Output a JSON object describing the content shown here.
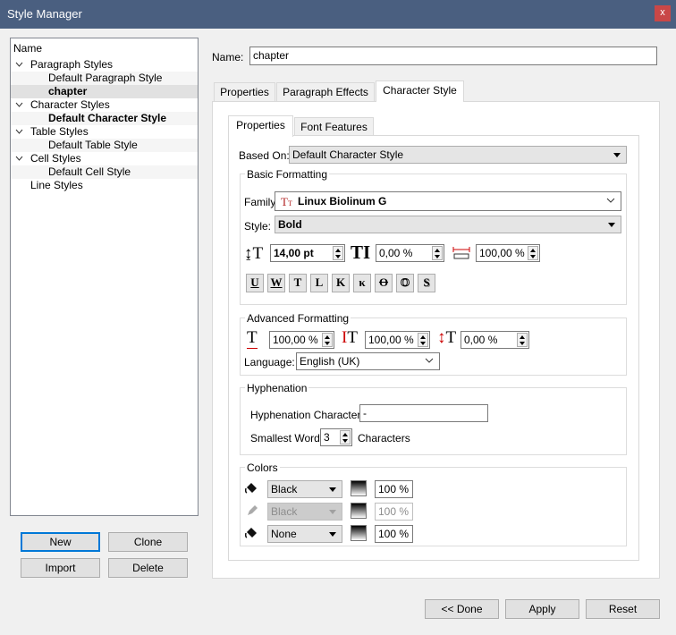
{
  "window": {
    "title": "Style Manager",
    "close_glyph": "x"
  },
  "tree": {
    "header": "Name",
    "items": [
      {
        "label": "Paragraph Styles"
      },
      {
        "label": "Default Paragraph Style"
      },
      {
        "label": "chapter"
      },
      {
        "label": "Character Styles"
      },
      {
        "label": "Default Character Style"
      },
      {
        "label": "Table Styles"
      },
      {
        "label": "Default Table Style"
      },
      {
        "label": "Cell Styles"
      },
      {
        "label": "Default Cell Style"
      },
      {
        "label": "Line Styles"
      }
    ]
  },
  "left_buttons": {
    "new": "New",
    "clone": "Clone",
    "import": "Import",
    "delete": "Delete"
  },
  "name_field": {
    "label": "Name:",
    "value": "chapter"
  },
  "outer_tabs": [
    "Properties",
    "Paragraph Effects",
    "Character Style"
  ],
  "inner_tabs": [
    "Properties",
    "Font Features"
  ],
  "based_on": {
    "label": "Based On:",
    "value": "Default Character Style"
  },
  "basic": {
    "title": "Basic Formatting",
    "family_label": "Family:",
    "family_icon": "truetype-font-icon",
    "family_value": "Linux Biolinum G",
    "style_label": "Style:",
    "style_value": "Bold",
    "font_size": "14,00 pt",
    "scale_height": "0,00 %",
    "scale_width": "100,00 %",
    "buttons": [
      {
        "name": "underline-button",
        "glyph": "U"
      },
      {
        "name": "underline-words-button",
        "glyph": "W"
      },
      {
        "name": "subscript-button",
        "glyph": "T"
      },
      {
        "name": "superscript-button",
        "glyph": "L"
      },
      {
        "name": "all-caps-button",
        "glyph": "K"
      },
      {
        "name": "small-caps-button",
        "glyph": "κ"
      },
      {
        "name": "strikethrough-button",
        "glyph": "O"
      },
      {
        "name": "outline-button",
        "glyph": "O"
      },
      {
        "name": "shadow-button",
        "glyph": "S"
      }
    ]
  },
  "advanced": {
    "title": "Advanced Formatting",
    "baseline": "100,00 %",
    "height": "100,00 %",
    "tracking": "0,00 %",
    "language_label": "Language:",
    "language_value": "English (UK)"
  },
  "hyphenation": {
    "title": "Hyphenation",
    "char_label": "Hyphenation Character:",
    "char_value": "-",
    "smallest_label": "Smallest Word:",
    "smallest_value": "3",
    "characters_label": "Characters"
  },
  "colors": {
    "title": "Colors",
    "rows": [
      {
        "icon": "fill-bucket-icon",
        "color": "Black",
        "shade": "100 %",
        "enabled": true
      },
      {
        "icon": "pen-icon",
        "color": "Black",
        "shade": "100 %",
        "enabled": false
      },
      {
        "icon": "fill-bucket-icon",
        "color": "None",
        "shade": "100 %",
        "enabled": true
      }
    ]
  },
  "bottom_buttons": {
    "done": "<< Done",
    "apply": "Apply",
    "reset": "Reset"
  }
}
